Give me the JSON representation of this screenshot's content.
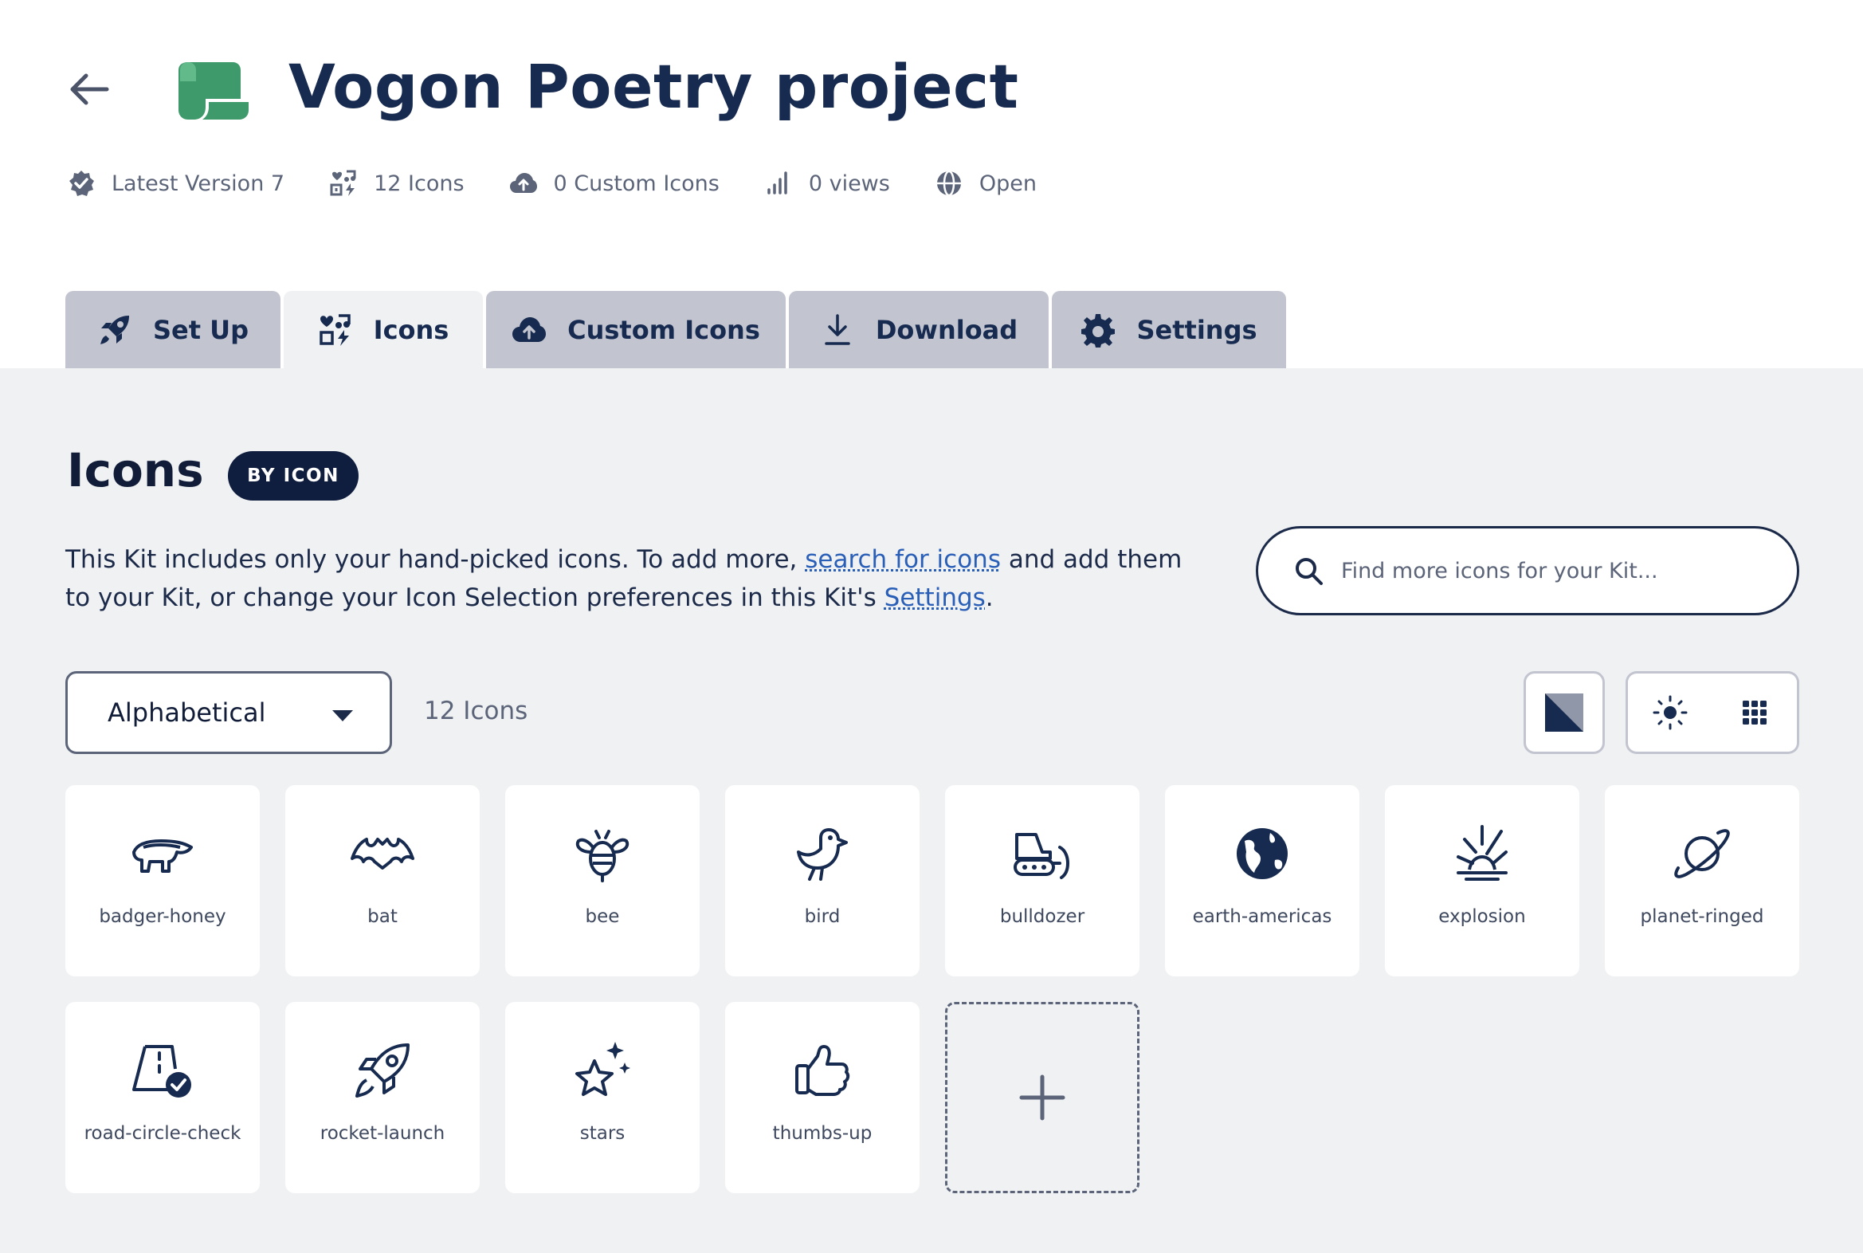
{
  "header": {
    "title": "Vogon Poetry project",
    "meta": [
      {
        "icon": "badge-check-icon",
        "label": "Latest Version 7"
      },
      {
        "icon": "icons-icon",
        "label": "12 Icons"
      },
      {
        "icon": "cloud-upload-icon",
        "label": "0 Custom Icons"
      },
      {
        "icon": "signal-icon",
        "label": "0 views"
      },
      {
        "icon": "globe-icon",
        "label": "Open"
      }
    ]
  },
  "tabs": [
    {
      "icon": "rocket-icon",
      "label": "Set Up",
      "active": false
    },
    {
      "icon": "icons-icon",
      "label": "Icons",
      "active": true
    },
    {
      "icon": "cloud-upload-icon",
      "label": "Custom Icons",
      "active": false
    },
    {
      "icon": "download-icon",
      "label": "Download",
      "active": false
    },
    {
      "icon": "gear-icon",
      "label": "Settings",
      "active": false
    }
  ],
  "main": {
    "section_title": "Icons",
    "badge": "BY ICON",
    "description": {
      "part1": "This Kit includes only your hand-picked icons. To add more, ",
      "link1": "search for icons",
      "part2": " and add them to your Kit, or change your Icon Selection preferences in this Kit's ",
      "link2": "Settings",
      "part3": "."
    },
    "search": {
      "placeholder": "Find more icons for your Kit..."
    },
    "sort": {
      "selected": "Alphabetical"
    },
    "icon_count": "12 Icons",
    "icons": [
      {
        "name": "badger-honey"
      },
      {
        "name": "bat"
      },
      {
        "name": "bee"
      },
      {
        "name": "bird"
      },
      {
        "name": "bulldozer"
      },
      {
        "name": "earth-americas"
      },
      {
        "name": "explosion"
      },
      {
        "name": "planet-ringed"
      },
      {
        "name": "road-circle-check"
      },
      {
        "name": "rocket-launch"
      },
      {
        "name": "stars"
      },
      {
        "name": "thumbs-up"
      }
    ]
  },
  "colors": {
    "navy": "#172a4f",
    "brand_green": "#3f9a6b",
    "panel_bg": "#f0f1f3",
    "tab_bg": "#c2c5d0",
    "link": "#2a5fb8"
  }
}
